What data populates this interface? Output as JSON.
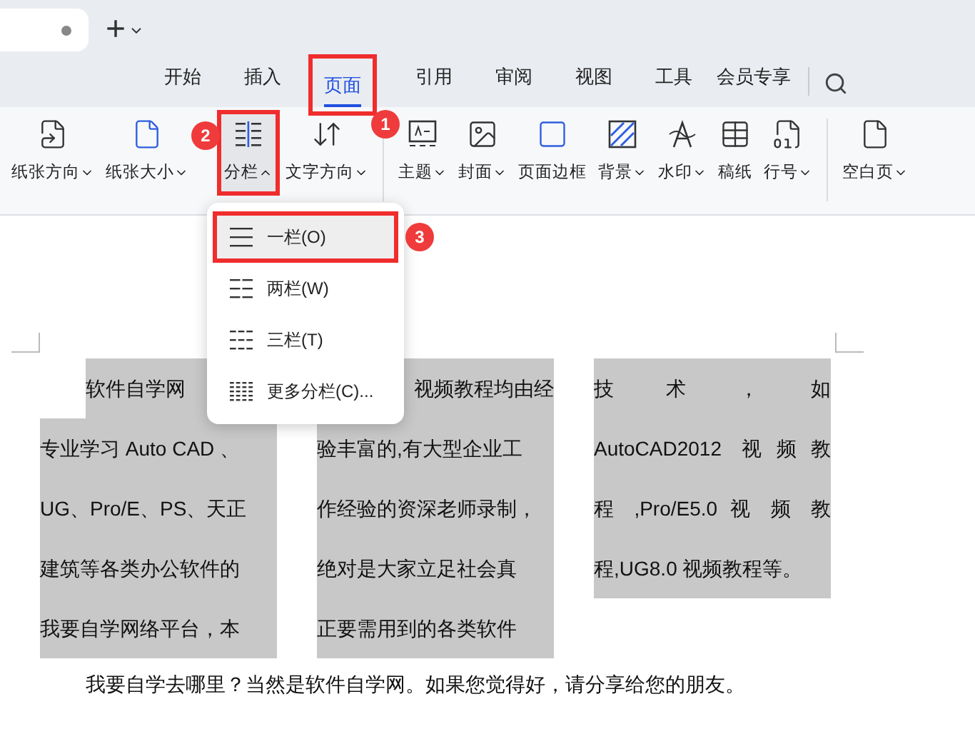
{
  "tab_strip": {
    "tab": {
      "modified": true
    },
    "new_tab": "+"
  },
  "ribbon_tabs": [
    {
      "label": "开始",
      "selected": false,
      "boxed": false
    },
    {
      "label": "插入",
      "selected": false,
      "boxed": false
    },
    {
      "label": "页面",
      "selected": true,
      "boxed": true,
      "callout": "1"
    },
    {
      "label": "引用",
      "selected": false,
      "boxed": false
    },
    {
      "label": "审阅",
      "selected": false,
      "boxed": false
    },
    {
      "label": "视图",
      "selected": false,
      "boxed": false
    },
    {
      "label": "工具",
      "selected": false,
      "boxed": false
    },
    {
      "label": "会员专享",
      "selected": false,
      "boxed": false
    }
  ],
  "toolbar": [
    {
      "kind": "orientation",
      "label": "纸张方向",
      "dropdown": true,
      "open": false,
      "boxed": false,
      "divider_before": false
    },
    {
      "kind": "size",
      "label": "纸张大小",
      "dropdown": true,
      "open": false,
      "boxed": false,
      "divider_before": false
    },
    {
      "kind": "columns",
      "label": "分栏",
      "dropdown": true,
      "open": true,
      "boxed": true,
      "callout": "2",
      "divider_before": false
    },
    {
      "kind": "direction",
      "label": "文字方向",
      "dropdown": true,
      "open": false,
      "boxed": false,
      "divider_before": false
    },
    {
      "kind": "theme",
      "label": "主题",
      "dropdown": true,
      "open": false,
      "boxed": false,
      "divider_before": true
    },
    {
      "kind": "cover",
      "label": "封面",
      "dropdown": true,
      "open": false,
      "boxed": false,
      "divider_before": false
    },
    {
      "kind": "border",
      "label": "页面边框",
      "dropdown": false,
      "open": false,
      "boxed": false,
      "divider_before": false
    },
    {
      "kind": "background",
      "label": "背景",
      "dropdown": true,
      "open": false,
      "boxed": false,
      "divider_before": false
    },
    {
      "kind": "watermark",
      "label": "水印",
      "dropdown": true,
      "open": false,
      "boxed": false,
      "divider_before": false
    },
    {
      "kind": "grid",
      "label": "稿纸",
      "dropdown": false,
      "open": false,
      "boxed": false,
      "divider_before": false
    },
    {
      "kind": "linenum",
      "label": "行号",
      "dropdown": true,
      "open": false,
      "boxed": false,
      "divider_before": false
    },
    {
      "kind": "blank",
      "label": "空白页",
      "dropdown": true,
      "open": false,
      "boxed": false,
      "divider_before": true
    }
  ],
  "columns_menu": [
    {
      "kind": "one",
      "label": "一栏(O)",
      "selected": true,
      "boxed": true,
      "callout": "3"
    },
    {
      "kind": "two",
      "label": "两栏(W)",
      "selected": false,
      "boxed": false
    },
    {
      "kind": "three",
      "label": "三栏(T)",
      "selected": false,
      "boxed": false
    },
    {
      "kind": "more",
      "label": "更多分栏(C)...",
      "selected": false,
      "boxed": false
    }
  ],
  "document": {
    "columns": [
      {
        "lines": [
          "软件自学网",
          "专业学习 Auto CAD 、",
          "UG、Pro/E、PS、天正",
          "建筑等各类办公软件的",
          "我要自学网络平台，本"
        ]
      },
      {
        "lines": [
          "视频教程均由经",
          "验丰富的,有大型企业工",
          "作经验的资深老师录制，",
          "绝对是大家立足社会真",
          "正要需用到的各类软件"
        ]
      },
      {
        "lines": [
          "技　　术　　，　　如",
          "AutoCAD2012 视频教",
          "程 ,Pro/E5.0 视 频 教",
          "程,UG8.0 视频教程等。"
        ]
      }
    ],
    "paragraph": "我要自学去哪里？当然是软件自学网。如果您觉得好，请分享给您的朋友。"
  }
}
